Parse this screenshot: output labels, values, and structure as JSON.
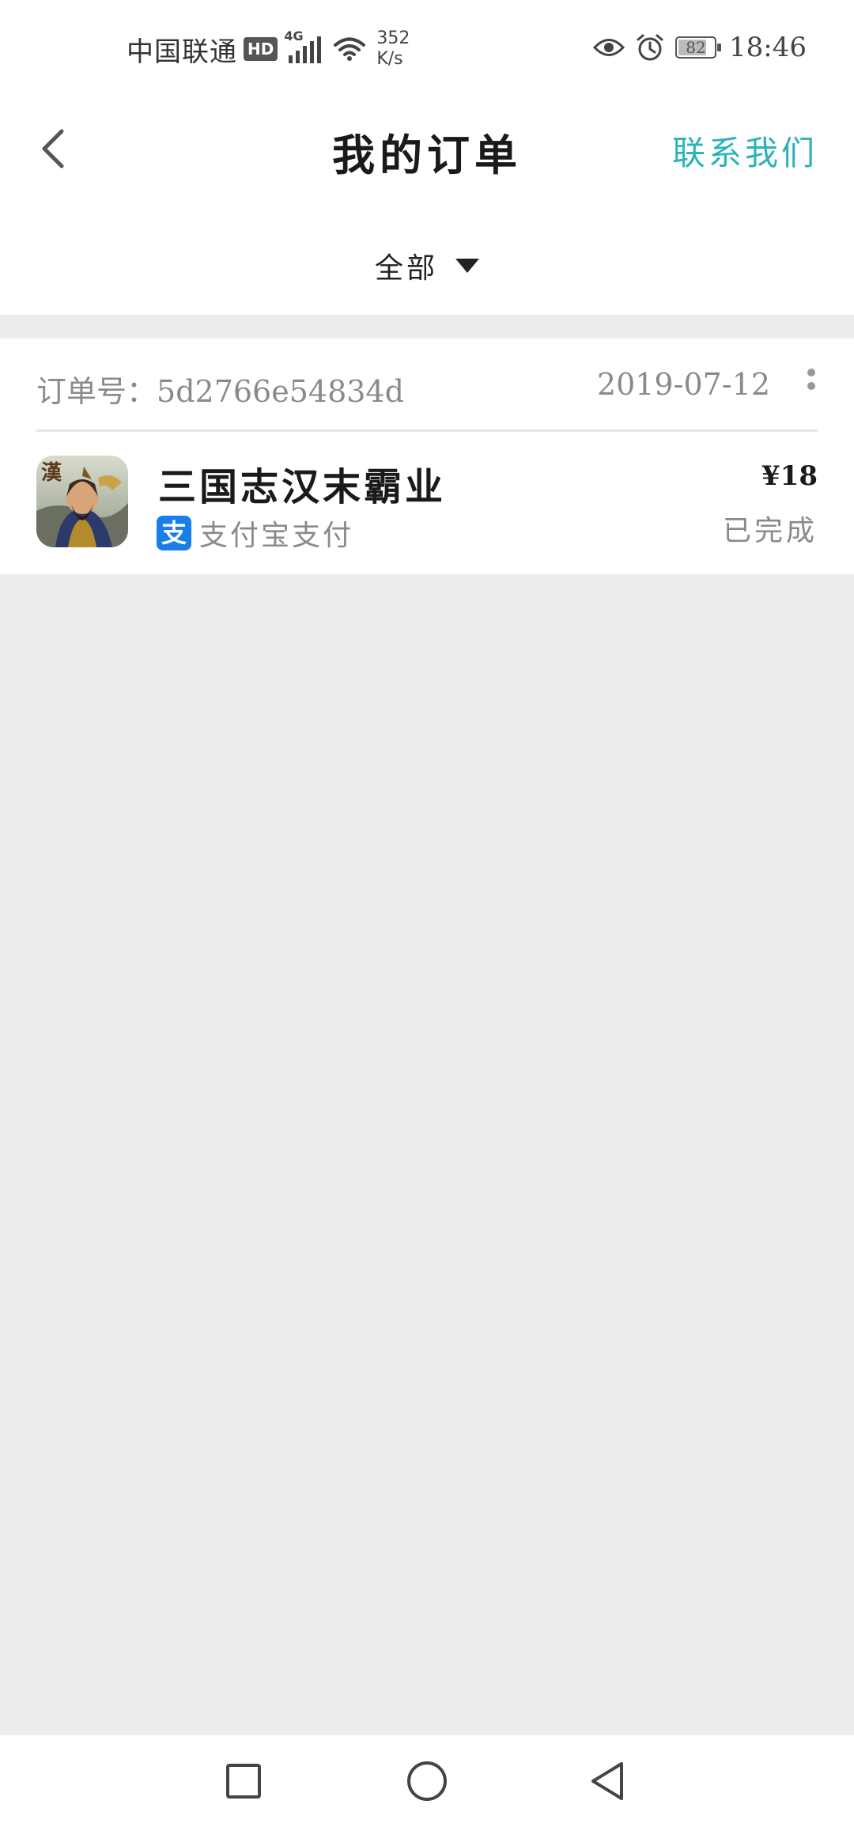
{
  "status_bar": {
    "carrier": "中国联通",
    "hd_badge": "HD",
    "network": "4G",
    "speed_value": "352",
    "speed_unit": "K/s",
    "battery_level": "82",
    "time": "18:46"
  },
  "header": {
    "title": "我的订单",
    "contact_label": "联系我们",
    "accent_color": "#2bb3b8"
  },
  "filter": {
    "selected": "全部"
  },
  "orders": [
    {
      "order_no_label": "订单号：",
      "order_no": "5d2766e54834d",
      "date": "2019-07-12",
      "game_name": "三国志汉末霸业",
      "icon_text": "漢",
      "payment_icon": "支",
      "payment_method": "支付宝支付",
      "price": "¥18",
      "status": "已完成"
    }
  ],
  "icons": {
    "back": "chevron-left-icon",
    "dropdown": "triangle-down-icon",
    "more": "vertical-dots-icon",
    "nav_recent": "square-icon",
    "nav_home": "circle-icon",
    "nav_back": "triangle-left-icon"
  }
}
